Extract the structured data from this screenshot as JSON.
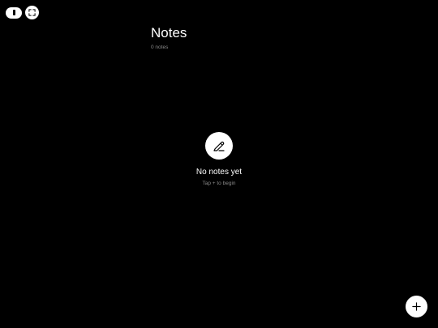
{
  "header": {
    "title": "Notes",
    "count": "0 notes"
  },
  "empty_state": {
    "icon": "pencil-icon",
    "title": "No notes yet",
    "hint": "Tap + to begin"
  },
  "controls": {
    "pause_icon": "pause-icon",
    "fullscreen_icon": "fullscreen-icon",
    "add_icon": "plus-icon"
  },
  "colors": {
    "background": "#000000",
    "foreground": "#ffffff",
    "muted": "#8a8a8a"
  }
}
